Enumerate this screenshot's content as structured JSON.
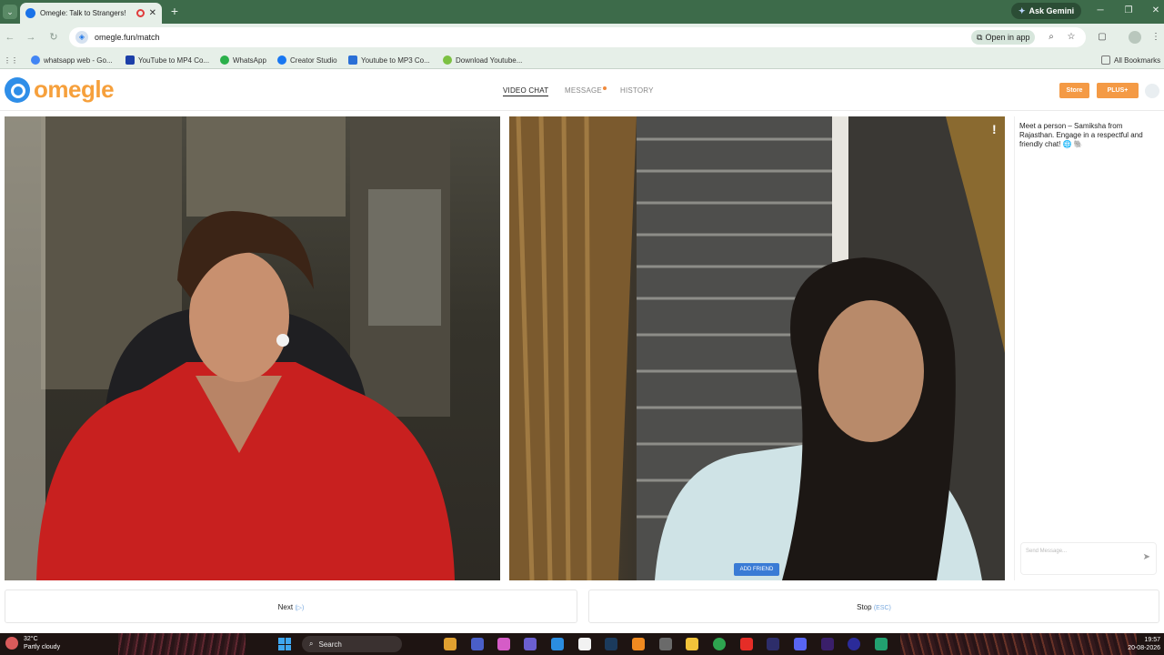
{
  "browser": {
    "tab_title": "Omegle: Talk to Strangers!",
    "new_tab_symbol": "+",
    "ask_gemini": "Ask Gemini",
    "url": "omegle.fun/match",
    "open_in_app": "Open in app",
    "all_bookmarks": "All Bookmarks",
    "bookmarks": [
      {
        "label": "whatsapp web - Go...",
        "icon_color": "#4285f4"
      },
      {
        "label": "YouTube to MP4 Co...",
        "icon_color": "#1c3fa8"
      },
      {
        "label": "WhatsApp",
        "icon_color": "#2ab04a"
      },
      {
        "label": "Creator Studio",
        "icon_color": "#1877f2"
      },
      {
        "label": "Youtube to MP3 Co...",
        "icon_color": "#2a6fd6"
      },
      {
        "label": "Download Youtube...",
        "icon_color": "#7cc142"
      }
    ]
  },
  "site": {
    "logo_text": "omegle",
    "nav": {
      "video_chat": "VIDEO CHAT",
      "message": "MESSAGE",
      "history": "HISTORY"
    },
    "store_label": "Store",
    "plus_label": "PLUS+",
    "accent_color": "#f49a45"
  },
  "stranger": {
    "report_symbol": "!",
    "add_friend_label": "ADD FRIEND"
  },
  "chat": {
    "intro_message": "Meet a person – Samiksha from Rajasthan. Engage in a respectful and friendly chat! 🌐 🐘",
    "input_placeholder": "Send Message..."
  },
  "controls": {
    "next_label": "Next",
    "next_hint": "(▷)",
    "stop_label": "Stop",
    "stop_hint": "(ESC)"
  },
  "taskbar": {
    "temperature": "32°C",
    "weather": "Partly cloudy",
    "search_label": "Search",
    "time": "19:57",
    "date": "20-08-2026"
  }
}
